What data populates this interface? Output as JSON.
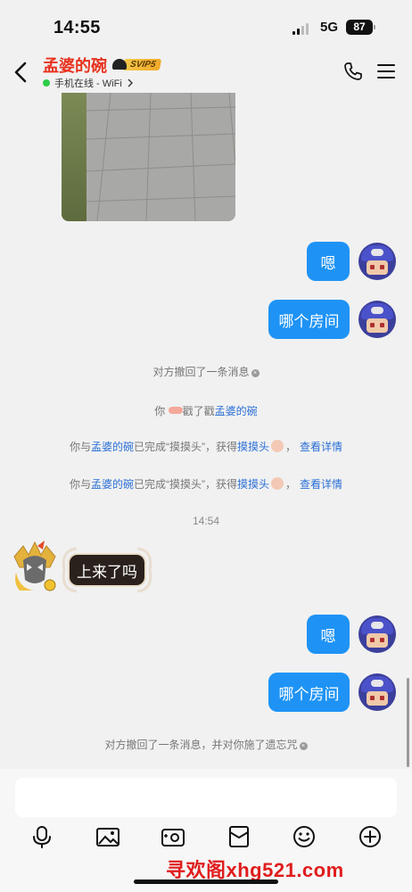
{
  "status_bar": {
    "time": "14:55",
    "network": "5G",
    "battery": "87"
  },
  "header": {
    "contact_name": "孟婆的碗",
    "vip_badge": "SVIP5",
    "status_text": "手机在线 - WiFi"
  },
  "messages": {
    "me_1": "嗯",
    "me_2": "哪个房间",
    "sys_recall": "对方撤回了一条消息",
    "poke_prefix": "你",
    "poke_mid": "戳了戳",
    "poke_name": "孟婆的碗",
    "touch_prefix": "你与",
    "touch_name": "孟婆的碗",
    "touch_mid": "已完成“摸摸头”，获得",
    "touch_reward": "摸摸头",
    "touch_detail": "查看详情",
    "timestamp": "14:54",
    "other_1": "上来了吗",
    "me_3": "嗯",
    "me_4": "哪个房间",
    "sys_recall_spell": "对方撤回了一条消息，并对你施了遗忘咒"
  },
  "watermark": "寻欢阁xhg521.com",
  "colors": {
    "accent": "#1e93f5",
    "name_red": "#e8321e",
    "link": "#2a6fd6"
  }
}
